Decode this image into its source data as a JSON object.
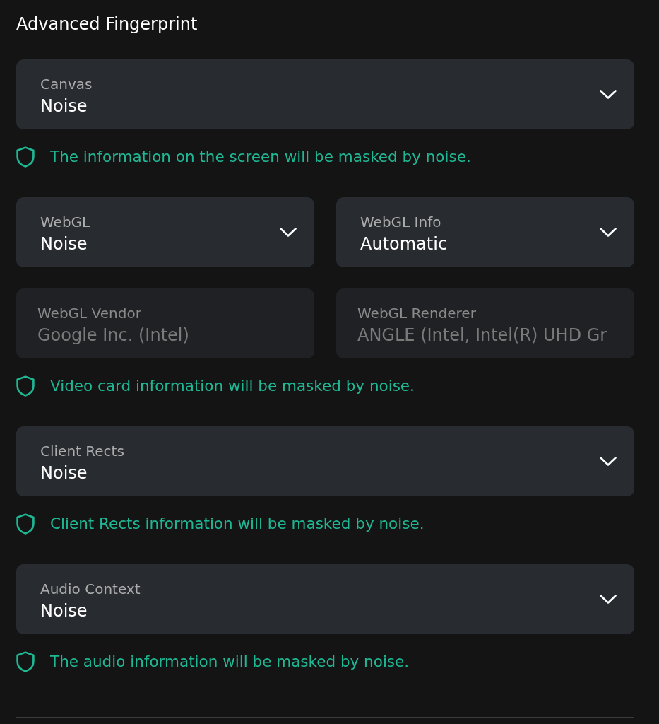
{
  "title": "Advanced Fingerprint",
  "sections": [
    {
      "rows": [
        [
          {
            "kind": "select",
            "label": "Canvas",
            "value": "Noise",
            "disabled": false
          }
        ]
      ],
      "note": "The information on the screen will be masked by noise."
    },
    {
      "rows": [
        [
          {
            "kind": "select",
            "label": "WebGL",
            "value": "Noise",
            "disabled": false
          },
          {
            "kind": "select",
            "label": "WebGL Info",
            "value": "Automatic",
            "disabled": false
          }
        ],
        [
          {
            "kind": "input",
            "label": "WebGL Vendor",
            "value": "Google Inc. (Intel)",
            "disabled": true
          },
          {
            "kind": "input",
            "label": "WebGL Renderer",
            "value": "ANGLE (Intel, Intel(R) UHD Gr",
            "disabled": true
          }
        ]
      ],
      "note": "Video card information will be masked by noise."
    },
    {
      "rows": [
        [
          {
            "kind": "select",
            "label": "Client Rects",
            "value": "Noise",
            "disabled": false
          }
        ]
      ],
      "note": "Client Rects information will be masked by noise."
    },
    {
      "rows": [
        [
          {
            "kind": "select",
            "label": "Audio Context",
            "value": "Noise",
            "disabled": false
          }
        ]
      ],
      "note": "The audio information will be masked by noise."
    }
  ]
}
